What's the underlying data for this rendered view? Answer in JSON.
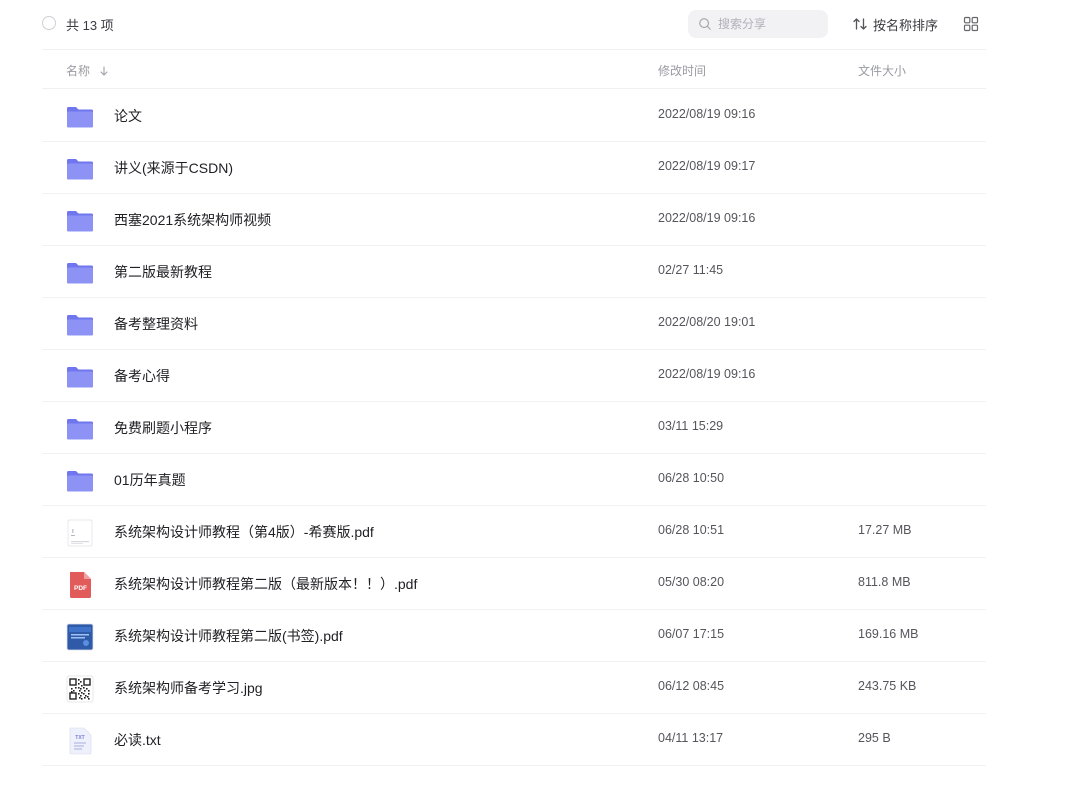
{
  "toolbar": {
    "count_label": "共 13 项",
    "search_placeholder": "搜索分享",
    "sort_label": "按名称排序"
  },
  "columns": {
    "name": "名称",
    "modified": "修改时间",
    "size": "文件大小"
  },
  "files": [
    {
      "name": "论文",
      "modified": "2022/08/19 09:16",
      "size": "",
      "icon": "folder-icon"
    },
    {
      "name": "讲义(来源于CSDN)",
      "modified": "2022/08/19 09:17",
      "size": "",
      "icon": "folder-icon"
    },
    {
      "name": "西塞2021系统架构师视频",
      "modified": "2022/08/19 09:16",
      "size": "",
      "icon": "folder-icon"
    },
    {
      "name": "第二版最新教程",
      "modified": "02/27 11:45",
      "size": "",
      "icon": "folder-icon"
    },
    {
      "name": "备考整理资料",
      "modified": "2022/08/20 19:01",
      "size": "",
      "icon": "folder-icon"
    },
    {
      "name": "备考心得",
      "modified": "2022/08/19 09:16",
      "size": "",
      "icon": "folder-icon"
    },
    {
      "name": "免费刷题小程序",
      "modified": "03/11 15:29",
      "size": "",
      "icon": "folder-icon"
    },
    {
      "name": "01历年真题",
      "modified": "06/28 10:50",
      "size": "",
      "icon": "folder-icon"
    },
    {
      "name": "系统架构设计师教程（第4版）-希赛版.pdf",
      "modified": "06/28 10:51",
      "size": "17.27 MB",
      "icon": "document-thumbnail-icon"
    },
    {
      "name": "系统架构设计师教程第二版（最新版本！！）.pdf",
      "modified": "05/30 08:20",
      "size": "811.8 MB",
      "icon": "pdf-icon"
    },
    {
      "name": "系统架构设计师教程第二版(书签).pdf",
      "modified": "06/07 17:15",
      "size": "169.16 MB",
      "icon": "book-cover-thumbnail-icon"
    },
    {
      "name": "系统架构师备考学习.jpg",
      "modified": "06/12 08:45",
      "size": "243.75 KB",
      "icon": "qr-code-thumbnail-icon"
    },
    {
      "name": "必读.txt",
      "modified": "04/11 13:17",
      "size": "295 B",
      "icon": "txt-file-icon"
    }
  ],
  "icon_labels": {
    "pdf": "PDF",
    "txt": "TXT"
  },
  "colors": {
    "folder": "#8d93f5",
    "folder_back": "#6f76ee",
    "pdf": "#e15b5b",
    "book_cover": "#2e5aa8",
    "text_primary": "#1f1f24",
    "text_secondary": "#55555c"
  }
}
